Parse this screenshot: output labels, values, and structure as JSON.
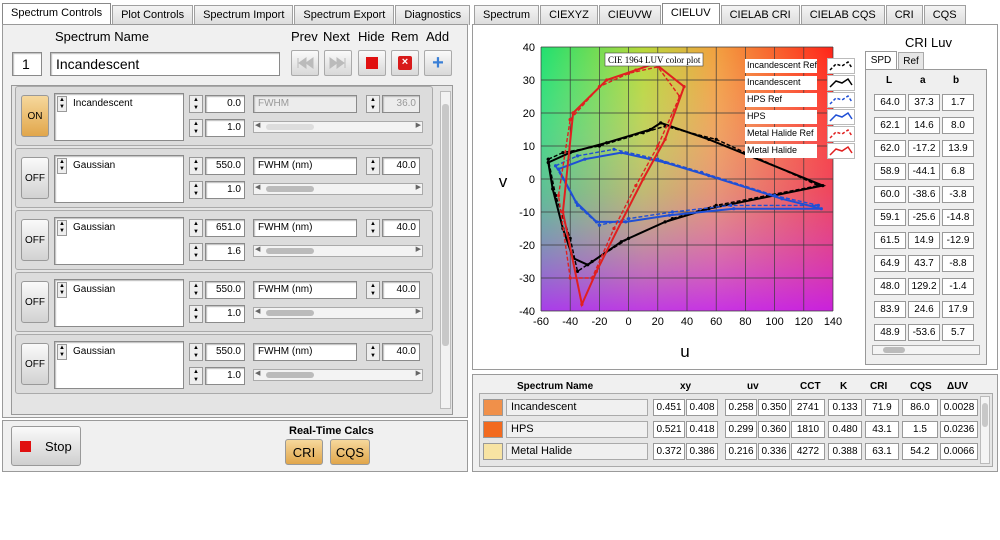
{
  "left_tabs": [
    "Spectrum Controls",
    "Plot Controls",
    "Spectrum Import",
    "Spectrum Export",
    "Diagnostics"
  ],
  "left_active_tab": 0,
  "right_tabs": [
    "Spectrum",
    "CIEXYZ",
    "CIEUVW",
    "CIELUV",
    "CIELAB CRI",
    "CIELAB CQS",
    "CRI",
    "CQS"
  ],
  "right_active_tab": 3,
  "spectrum_header": {
    "name_label": "Spectrum Name",
    "prev": "Prev",
    "next": "Next",
    "hide": "Hide",
    "rem": "Rem",
    "add": "Add"
  },
  "spectrum_index": "1",
  "spectrum_name": "Incandescent",
  "components": [
    {
      "state": "ON",
      "type": "Incandescent",
      "v1": "0.0",
      "v2": "1.0",
      "fw_label": "FWHM",
      "fw_value": "36.0",
      "disabled": true
    },
    {
      "state": "OFF",
      "type": "Gaussian",
      "v1": "550.0",
      "v2": "1.0",
      "fw_label": "FWHM (nm)",
      "fw_value": "40.0",
      "disabled": false
    },
    {
      "state": "OFF",
      "type": "Gaussian",
      "v1": "651.0",
      "v2": "1.6",
      "fw_label": "FWHM (nm)",
      "fw_value": "40.0",
      "disabled": false
    },
    {
      "state": "OFF",
      "type": "Gaussian",
      "v1": "550.0",
      "v2": "1.0",
      "fw_label": "FWHM (nm)",
      "fw_value": "40.0",
      "disabled": false
    },
    {
      "state": "OFF",
      "type": "Gaussian",
      "v1": "550.0",
      "v2": "1.0",
      "fw_label": "FWHM (nm)",
      "fw_value": "40.0",
      "disabled": false
    }
  ],
  "stop_label": "Stop",
  "realtime": {
    "label": "Real-Time Calcs",
    "cri": "CRI",
    "cqs": "CQS"
  },
  "plot": {
    "caption": "CIE 1964 LUV color plot",
    "xlabel": "u",
    "ylabel": "v",
    "xticks": [
      "-60",
      "-40",
      "-20",
      "0",
      "20",
      "40",
      "60",
      "80",
      "100",
      "120",
      "140"
    ],
    "yticks": [
      "40",
      "30",
      "20",
      "10",
      "0",
      "-10",
      "-20",
      "-30",
      "-40"
    ],
    "legend": [
      {
        "name": "Incandescent Ref",
        "color": "#000000",
        "dashed": true
      },
      {
        "name": "Incandescent",
        "color": "#000000",
        "dashed": false
      },
      {
        "name": "HPS Ref",
        "color": "#1f4fd6",
        "dashed": true
      },
      {
        "name": "HPS",
        "color": "#1f4fd6",
        "dashed": false
      },
      {
        "name": "Metal Halide Ref",
        "color": "#e02020",
        "dashed": true
      },
      {
        "name": "Metal Halide",
        "color": "#e02020",
        "dashed": false
      }
    ]
  },
  "chart_data": {
    "type": "line",
    "xlim": [
      -60,
      140
    ],
    "ylim": [
      -40,
      40
    ],
    "xlabel": "u",
    "ylabel": "v",
    "title": "CIE 1964 LUV color plot",
    "series": [
      {
        "name": "Incandescent Ref",
        "color": "#000000",
        "dashed": true,
        "points": [
          [
            -55,
            6
          ],
          [
            -45,
            8
          ],
          [
            -20,
            10
          ],
          [
            10,
            14
          ],
          [
            25,
            16
          ],
          [
            60,
            12
          ],
          [
            130,
            -2
          ],
          [
            60,
            -8
          ],
          [
            30,
            -12
          ],
          [
            0,
            -18
          ],
          [
            -25,
            -25
          ],
          [
            -35,
            -28
          ],
          [
            -40,
            -18
          ],
          [
            -50,
            -5
          ],
          [
            -55,
            6
          ]
        ]
      },
      {
        "name": "Incandescent",
        "color": "#000000",
        "dashed": false,
        "points": [
          [
            -55,
            5
          ],
          [
            -40,
            8
          ],
          [
            -15,
            11
          ],
          [
            15,
            15
          ],
          [
            22,
            17
          ],
          [
            55,
            12
          ],
          [
            133,
            -2
          ],
          [
            55,
            -9
          ],
          [
            25,
            -13
          ],
          [
            -5,
            -19
          ],
          [
            -28,
            -26
          ],
          [
            -38,
            -24
          ],
          [
            -45,
            -15
          ],
          [
            -52,
            -3
          ],
          [
            -55,
            5
          ]
        ]
      },
      {
        "name": "HPS Ref",
        "color": "#1f4fd6",
        "dashed": true,
        "points": [
          [
            -50,
            4
          ],
          [
            -35,
            7
          ],
          [
            -10,
            9
          ],
          [
            20,
            6
          ],
          [
            50,
            2
          ],
          [
            100,
            -5
          ],
          [
            130,
            -8
          ],
          [
            70,
            -8
          ],
          [
            30,
            -10
          ],
          [
            0,
            -12
          ],
          [
            -20,
            -14
          ],
          [
            -35,
            -8
          ],
          [
            -50,
            4
          ]
        ]
      },
      {
        "name": "HPS",
        "color": "#1f4fd6",
        "dashed": false,
        "points": [
          [
            -48,
            3
          ],
          [
            -30,
            6
          ],
          [
            -5,
            8
          ],
          [
            25,
            5
          ],
          [
            55,
            1
          ],
          [
            105,
            -6
          ],
          [
            132,
            -9
          ],
          [
            72,
            -9
          ],
          [
            28,
            -11
          ],
          [
            -2,
            -13
          ],
          [
            -22,
            -13
          ],
          [
            -36,
            -7
          ],
          [
            -48,
            3
          ]
        ]
      },
      {
        "name": "Metal Halide Ref",
        "color": "#e02020",
        "dashed": true,
        "points": [
          [
            -40,
            18
          ],
          [
            -20,
            28
          ],
          [
            0,
            32
          ],
          [
            20,
            34
          ],
          [
            35,
            25
          ],
          [
            20,
            10
          ],
          [
            5,
            -2
          ],
          [
            -10,
            -15
          ],
          [
            -25,
            -30
          ],
          [
            -40,
            -30
          ],
          [
            -48,
            -5
          ],
          [
            -40,
            18
          ]
        ]
      },
      {
        "name": "Metal Halide",
        "color": "#e02020",
        "dashed": false,
        "points": [
          [
            -38,
            20
          ],
          [
            -15,
            30
          ],
          [
            5,
            33
          ],
          [
            18,
            35
          ],
          [
            38,
            28
          ],
          [
            25,
            12
          ],
          [
            10,
            0
          ],
          [
            -5,
            -13
          ],
          [
            -22,
            -28
          ],
          [
            -32,
            -38
          ],
          [
            -45,
            -10
          ],
          [
            -38,
            20
          ]
        ]
      }
    ]
  },
  "cri_luv": {
    "title": "CRI Luv",
    "tabs": [
      "SPD",
      "Ref"
    ],
    "active_tab": 0,
    "headers": [
      "L",
      "a",
      "b"
    ],
    "rows": [
      [
        "64.0",
        "37.3",
        "1.7"
      ],
      [
        "62.1",
        "14.6",
        "8.0"
      ],
      [
        "62.0",
        "-17.2",
        "13.9"
      ],
      [
        "58.9",
        "-44.1",
        "6.8"
      ],
      [
        "60.0",
        "-38.6",
        "-3.8"
      ],
      [
        "59.1",
        "-25.6",
        "-14.8"
      ],
      [
        "61.5",
        "14.9",
        "-12.9"
      ],
      [
        "64.9",
        "43.7",
        "-8.8"
      ],
      [
        "48.0",
        "129.2",
        "-1.4"
      ],
      [
        "83.9",
        "24.6",
        "17.9"
      ],
      [
        "48.9",
        "-53.6",
        "5.7"
      ]
    ]
  },
  "results": {
    "headers": {
      "name": "Spectrum Name",
      "xy": "xy",
      "uv": "uv",
      "cct": "CCT",
      "k": "K",
      "cri": "CRI",
      "cqs": "CQS",
      "duv": "ΔUV"
    },
    "rows": [
      {
        "swatch": "#f0904a",
        "name": "Incandescent",
        "x": "0.451",
        "y": "0.408",
        "u": "0.258",
        "v": "0.350",
        "cct": "2741",
        "k": "0.133",
        "cri": "71.9",
        "cqs": "86.0",
        "duv": "0.0028"
      },
      {
        "swatch": "#f26a1f",
        "name": "HPS",
        "x": "0.521",
        "y": "0.418",
        "u": "0.299",
        "v": "0.360",
        "cct": "1810",
        "k": "0.480",
        "cri": "43.1",
        "cqs": "1.5",
        "duv": "0.0236"
      },
      {
        "swatch": "#f7e3a3",
        "name": "Metal Halide",
        "x": "0.372",
        "y": "0.386",
        "u": "0.216",
        "v": "0.336",
        "cct": "4272",
        "k": "0.388",
        "cri": "63.1",
        "cqs": "54.2",
        "duv": "0.0066"
      }
    ]
  }
}
